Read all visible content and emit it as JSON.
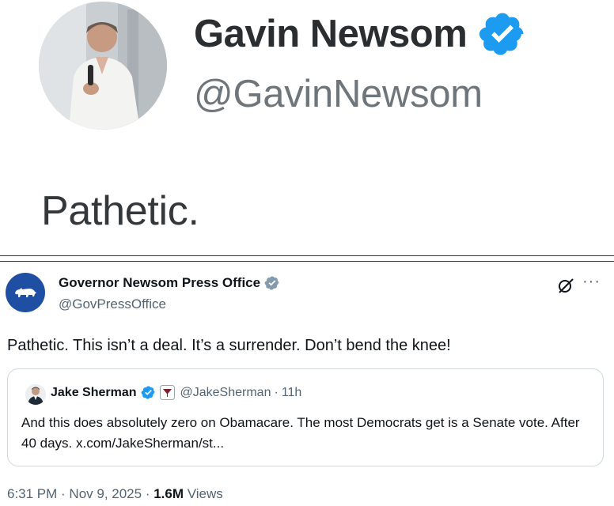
{
  "top_tweet": {
    "name": "Gavin Newsom",
    "handle": "@GavinNewsom",
    "text": "Pathetic."
  },
  "bottom_tweet": {
    "name": "Governor Newsom Press Office",
    "handle": "@GovPressOffice",
    "text": "Pathetic. This isn’t a deal. It’s a surrender. Don’t bend the knee!",
    "more_label": "···",
    "quoted": {
      "name": "Jake Sherman",
      "handle": "@JakeSherman",
      "separator": "·",
      "time": "11h",
      "text": "And this does absolutely zero on Obamacare. The most Democrats get is a Senate vote. After 40 days. x.com/JakeSherman/st..."
    },
    "meta": {
      "time": "6:31 PM",
      "sep1": " · ",
      "date": "Nov 9, 2025",
      "sep2": " · ",
      "views_count": "1.6M",
      "views_label": " Views"
    }
  },
  "colors": {
    "verified_blue": "#1d9bf0",
    "government_gray": "#829aab",
    "secondary_text": "#536471",
    "avatar_seal_blue": "#1f4fa3"
  }
}
